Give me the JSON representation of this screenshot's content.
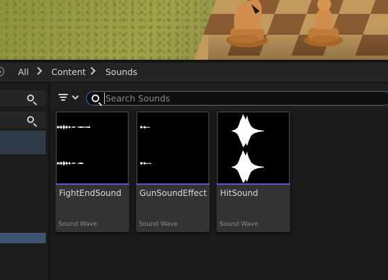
{
  "breadcrumb": {
    "items": [
      "All",
      "Content",
      "Sounds"
    ]
  },
  "search": {
    "placeholder": "Search Sounds",
    "value": ""
  },
  "assets": [
    {
      "name": "FightEndSound",
      "type": "Sound Wave",
      "accent": "#6b4fd1"
    },
    {
      "name": "GunSoundEffect",
      "type": "Sound Wave",
      "accent": "#6b4fd1"
    },
    {
      "name": "HitSound",
      "type": "Sound Wave",
      "accent": "#6b4fd1"
    }
  ],
  "colors": {
    "search_border": "#2f6fc6",
    "selection": "#3b5573",
    "sound_wave_accent": "#6b4fd1"
  }
}
